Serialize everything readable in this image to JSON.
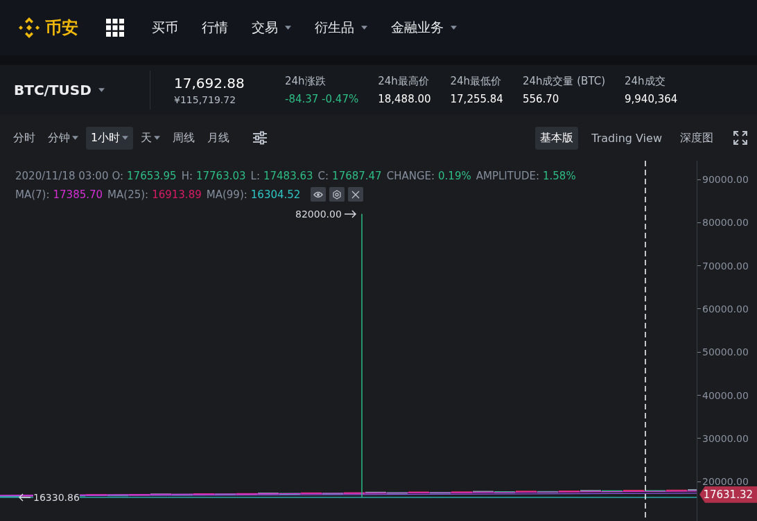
{
  "nav": {
    "logo": "币安",
    "items": [
      {
        "label": "买币",
        "dropdown": false
      },
      {
        "label": "行情",
        "dropdown": false
      },
      {
        "label": "交易",
        "dropdown": true
      },
      {
        "label": "衍生品",
        "dropdown": true
      },
      {
        "label": "金融业务",
        "dropdown": true
      }
    ]
  },
  "ticker": {
    "pair": "BTC/TUSD",
    "last_price": "17,692.88",
    "fiat_price": "¥115,719.72",
    "stats": [
      {
        "label": "24h涨跌",
        "value": "-84.37 -0.47%",
        "kind": "change"
      },
      {
        "label": "24h最高价",
        "value": "18,488.00",
        "kind": "plain"
      },
      {
        "label": "24h最低价",
        "value": "17,255.84",
        "kind": "plain"
      },
      {
        "label": "24h成交量 (BTC)",
        "value": "556.70",
        "kind": "plain"
      },
      {
        "label": "24h成交",
        "value": "9,940,364",
        "kind": "plain"
      }
    ]
  },
  "toolbar": {
    "intervals": [
      {
        "label": "分时",
        "dropdown": false,
        "selected": false
      },
      {
        "label": "分钟",
        "dropdown": true,
        "selected": false
      },
      {
        "label": "1小时",
        "dropdown": true,
        "selected": true
      },
      {
        "label": "天",
        "dropdown": true,
        "selected": false
      },
      {
        "label": "周线",
        "dropdown": false,
        "selected": false
      },
      {
        "label": "月线",
        "dropdown": false,
        "selected": false
      }
    ],
    "views": [
      {
        "label": "基本版",
        "selected": true
      },
      {
        "label": "Trading View",
        "selected": false
      },
      {
        "label": "深度图",
        "selected": false
      }
    ]
  },
  "legend": {
    "time": "2020/11/18 03:00",
    "ohlc": [
      {
        "label": "O:",
        "value": "17653.95"
      },
      {
        "label": "H:",
        "value": "17763.03"
      },
      {
        "label": "L:",
        "value": "17483.63"
      },
      {
        "label": "C:",
        "value": "17687.47"
      },
      {
        "label": "CHANGE:",
        "value": "0.19%"
      },
      {
        "label": "AMPLITUDE:",
        "value": "1.58%"
      }
    ],
    "ma": [
      {
        "label": "MA(7):",
        "value": "17385.70",
        "color": "#d62fd6"
      },
      {
        "label": "MA(25):",
        "value": "16913.89",
        "color": "#d81b67"
      },
      {
        "label": "MA(99):",
        "value": "16304.52",
        "color": "#2fc6c6"
      }
    ]
  },
  "chart": {
    "axis_labels": [
      "90000.00",
      "80000.00",
      "70000.00",
      "60000.00",
      "50000.00",
      "40000.00",
      "30000.00",
      "20000.00"
    ],
    "high_marker": "82000.00",
    "low_marker": "16330.86",
    "current_price": "17631.32"
  }
}
